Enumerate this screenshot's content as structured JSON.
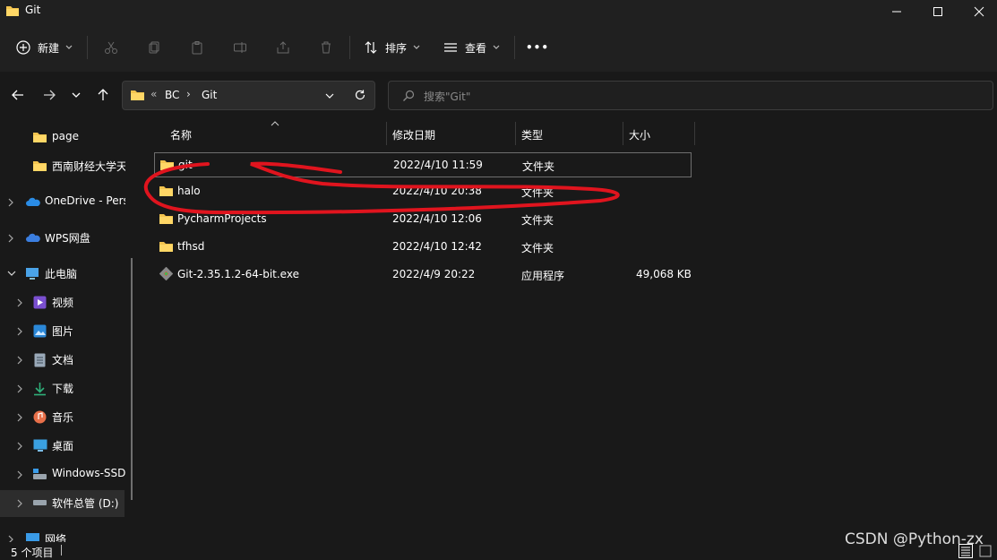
{
  "window": {
    "title": "Git"
  },
  "toolbar": {
    "new_label": "新建",
    "sort_label": "排序",
    "view_label": "查看",
    "more_label": "•••"
  },
  "address": {
    "overflow": "«",
    "crumbs": [
      "BC",
      "Git"
    ],
    "separator": "›"
  },
  "search": {
    "placeholder": "搜索\"Git\""
  },
  "sidebar": {
    "items": [
      {
        "label": "page",
        "icon": "folder-icon"
      },
      {
        "label": "西南财经大学天",
        "icon": "folder-icon"
      },
      {
        "label": "OneDrive - Pers",
        "icon": "cloud-icon"
      },
      {
        "label": "WPS网盘",
        "icon": "cloud-icon"
      },
      {
        "label": "此电脑",
        "icon": "computer-icon"
      },
      {
        "label": "视频",
        "icon": "video-icon"
      },
      {
        "label": "图片",
        "icon": "pictures-icon"
      },
      {
        "label": "文档",
        "icon": "document-icon"
      },
      {
        "label": "下载",
        "icon": "download-icon"
      },
      {
        "label": "音乐",
        "icon": "music-icon"
      },
      {
        "label": "桌面",
        "icon": "desktop-icon"
      },
      {
        "label": "Windows-SSD",
        "icon": "drive-icon"
      },
      {
        "label": "软件总管 (D:)",
        "icon": "drive-icon"
      },
      {
        "label": "网络",
        "icon": "network-icon"
      }
    ]
  },
  "columns": [
    "名称",
    "修改日期",
    "类型",
    "大小"
  ],
  "files": [
    {
      "name": "git",
      "date": "2022/4/10 11:59",
      "type": "文件夹",
      "size": ""
    },
    {
      "name": "halo",
      "date": "2022/4/10 20:38",
      "type": "文件夹",
      "size": ""
    },
    {
      "name": "PycharmProjects",
      "date": "2022/4/10 12:06",
      "type": "文件夹",
      "size": ""
    },
    {
      "name": "tfhsd",
      "date": "2022/4/10 12:42",
      "type": "文件夹",
      "size": ""
    },
    {
      "name": "Git-2.35.1.2-64-bit.exe",
      "date": "2022/4/9 20:22",
      "type": "应用程序",
      "size": "49,068 KB"
    }
  ],
  "status": {
    "count_text": "5 个项目"
  },
  "watermark": "CSDN @Python-zx",
  "colors": {
    "folder": "#f3c44f",
    "accent_red": "#e0141e",
    "background": "#191919",
    "chrome": "#202020"
  }
}
